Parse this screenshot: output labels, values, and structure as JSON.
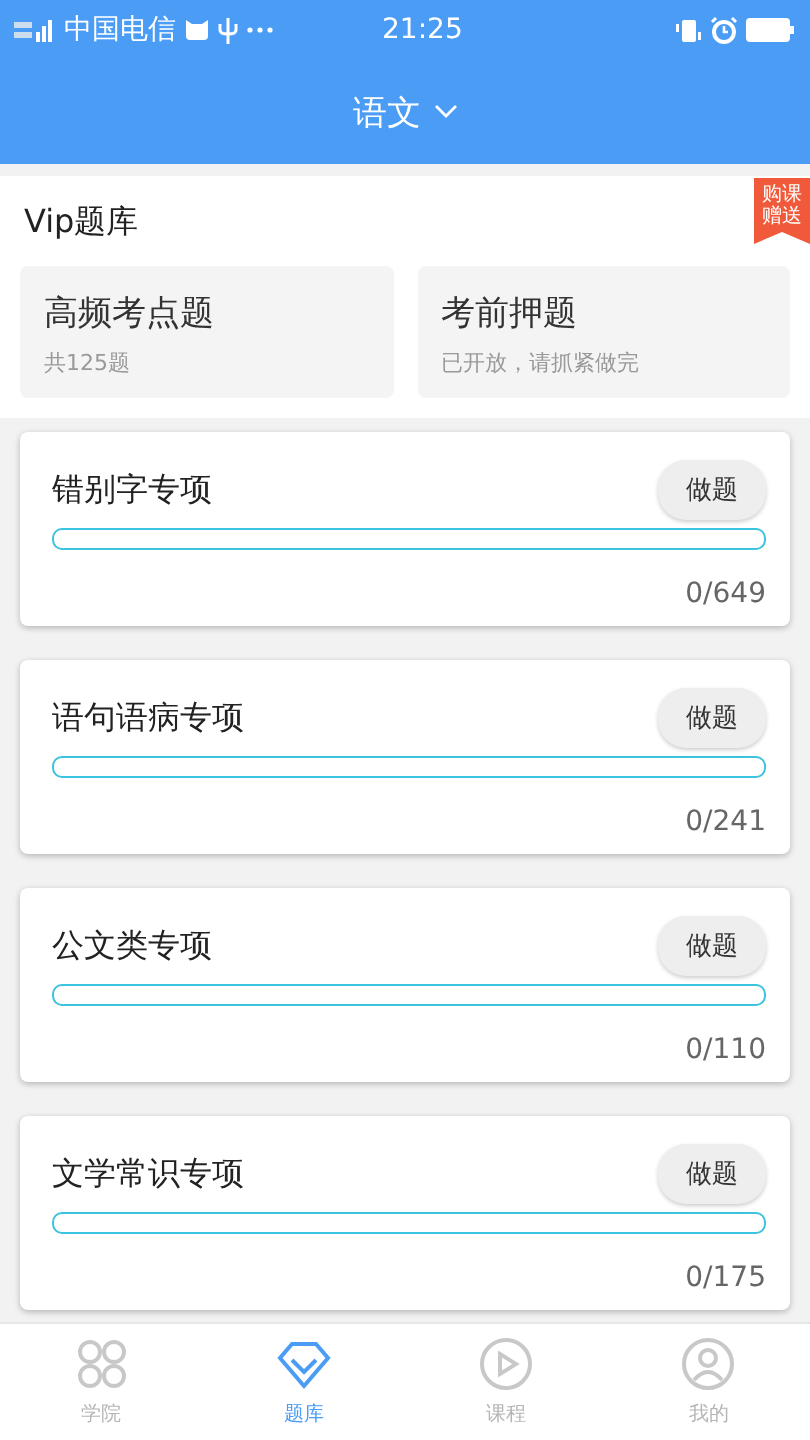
{
  "status_bar": {
    "carrier": "中国电信",
    "time": "21:25"
  },
  "header": {
    "title": "语文"
  },
  "vip": {
    "title": "Vip题库",
    "ribbon": "购课赠送",
    "cards": [
      {
        "title": "高频考点题",
        "subtitle": "共125题"
      },
      {
        "title": "考前押题",
        "subtitle": "已开放，请抓紧做完"
      }
    ]
  },
  "topics": [
    {
      "name": "错别字专项",
      "button": "做题",
      "level": 0,
      "progress": "0/649"
    },
    {
      "name": "语句语病专项",
      "button": "做题",
      "level": 0,
      "progress": "0/241"
    },
    {
      "name": "公文类专项",
      "button": "做题",
      "level": 0,
      "progress": "0/110"
    },
    {
      "name": "文学常识专项",
      "button": "做题",
      "level": 0,
      "progress": "0/175"
    }
  ],
  "tab_bar": [
    {
      "label": "学院",
      "kind": "grid",
      "selected": false
    },
    {
      "label": "题库",
      "kind": "diamond",
      "selected": true
    },
    {
      "label": "课程",
      "kind": "play",
      "selected": false
    },
    {
      "label": "我的",
      "kind": "person",
      "selected": false
    }
  ]
}
